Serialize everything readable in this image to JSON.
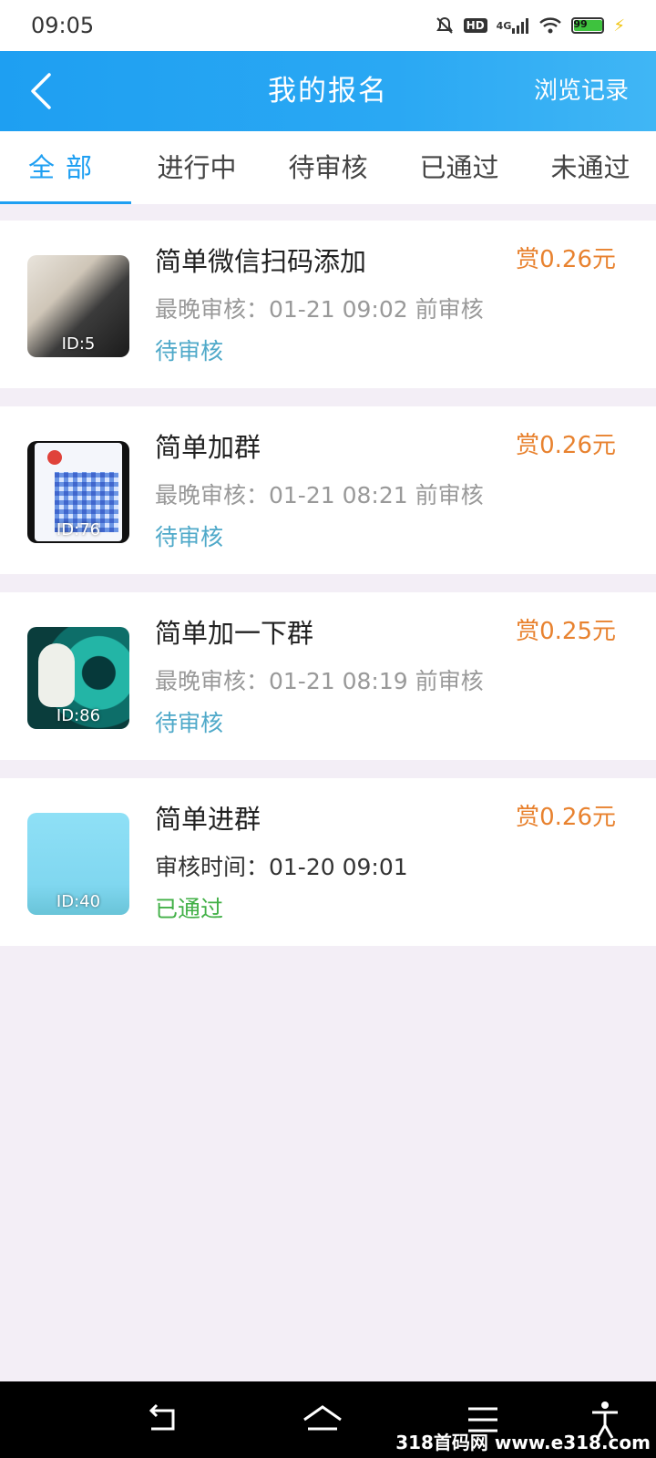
{
  "status_bar": {
    "time": "09:05",
    "battery": "99",
    "network": "4G",
    "hd": "HD"
  },
  "appbar": {
    "title": "我的报名",
    "history_label": "浏览记录"
  },
  "tabs": [
    {
      "label": "全部",
      "active": true
    },
    {
      "label": "进行中",
      "active": false
    },
    {
      "label": "待审核",
      "active": false
    },
    {
      "label": "已通过",
      "active": false
    },
    {
      "label": "未通过",
      "active": false
    }
  ],
  "tasks": [
    {
      "id_label": "ID:5",
      "name": "简单微信扫码添加",
      "reward": "赏0.26元",
      "meta": "最晚审核：01-21 09:02 前审核",
      "status": "待审核"
    },
    {
      "id_label": "ID:76",
      "name": "简单加群",
      "reward": "赏0.26元",
      "meta": "最晚审核：01-21 08:21 前审核",
      "status": "待审核"
    },
    {
      "id_label": "ID:86",
      "name": "简单加一下群",
      "reward": "赏0.25元",
      "meta": "最晚审核：01-21 08:19 前审核",
      "status": "待审核"
    },
    {
      "id_label": "ID:40",
      "name": "简单进群",
      "reward": "赏0.26元",
      "meta": "审核时间：01-20 09:01",
      "status": "已通过"
    }
  ],
  "watermark": "318首码网 www.e318.com",
  "colors": {
    "primary": "#1e9ff2",
    "reward": "#e8822f",
    "pending": "#4fa9c9",
    "passed": "#42b047",
    "background": "#f3eef6"
  }
}
